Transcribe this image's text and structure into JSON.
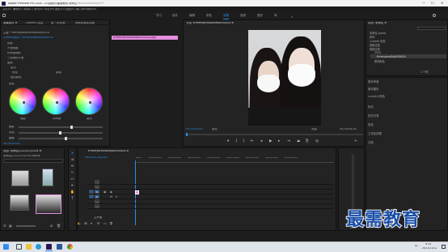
{
  "window": {
    "title": "Adobe Premiere Pro 2020 - D:\\视频\\5\\最需教育 未命名 *7777777777777 *",
    "controls": [
      "—",
      "☐",
      "✕"
    ]
  },
  "menu": [
    "文件(F)",
    "编辑(E)",
    "剪辑(C)",
    "序列(S)",
    "标记(M)",
    "图形(G)",
    "视图(V)",
    "窗口(W)",
    "帮助(H)"
  ],
  "workspaces": {
    "items": [
      "学习",
      "组件",
      "编辑",
      "颜色",
      "效果",
      "音频",
      "图形",
      "库"
    ],
    "active_index": 4
  },
  "effect_controls": {
    "tabs": [
      "效果控件 ≡",
      "Lumetri 范围",
      "源（无剪辑）",
      "音频剪辑混合器"
    ],
    "source_label": "主要 * trimmyand0a00ds0000024",
    "clip_label": "Lumetri颜色 * trimmyand0a0000024",
    "clip_bar_label": "trimmyand0a00ds0000024.jpg",
    "items": [
      "视频",
      "不透明度",
      "时间重映射",
      "三色调色平衡",
      "曲线"
    ],
    "lumetri_rows": [
      "高光",
      "更改颜色"
    ],
    "preset_label": "预设",
    "preset_value": "原始",
    "wheels_label": "色轮",
    "wheel_labels": [
      "阴影",
      "中间调",
      "高光"
    ],
    "sliders": [
      {
        "label": "晕影",
        "value": 0.62
      },
      {
        "label": "羽化",
        "value": 0.48
      },
      {
        "label": "圆度",
        "value": 0.55
      }
    ],
    "timecode": "00:00:00:00"
  },
  "program_monitor": {
    "title": "节目: trimmyand0a00ds0000024 ≡",
    "timecode_left": "00;00;00;00",
    "fit_label": "适合",
    "quality_label": "完整",
    "timecode_right": "00;00;04;24"
  },
  "project": {
    "title": "项目: 未命名 ≡",
    "subtitle": "未命名.prproj",
    "items": [
      "未命名.prproj",
      "序列",
      "Lumetri 颜色",
      "音频过渡",
      "视频过渡",
      "2020",
      "trimmyand0a0000024",
      "更改颜色"
    ],
    "item_count": "1 个项"
  },
  "right_side_panels": [
    "基本声音",
    "基本图形",
    "Lumetri 颜色",
    "标记",
    "历史记录",
    "信息",
    "工作区设置",
    "文档"
  ],
  "media": {
    "title": "项目: 未命名(222222)2224 ≡",
    "subtitle": "未命名(222222)2224.prproj"
  },
  "timeline": {
    "title": "trimmyand0a00ds0000024 ≡",
    "timecode": "00;00;00;00",
    "ruler": [
      "00;00",
      "00;00;02;00",
      "00;00;04;00",
      "00;00;06;00",
      "00;00;08;00",
      "00;00;10;00",
      "00;00;12;00",
      "00;00;14;00",
      "00;00;16;00"
    ],
    "tracks": [
      "V3",
      "V2",
      "V1",
      "A1",
      "A2",
      "A3"
    ],
    "master_label": "主声道"
  },
  "watermark": "最需教育",
  "taskbar": {
    "time": "9:14",
    "date": "2021/11/12",
    "lang": "中"
  },
  "colors": {
    "accent": "#2d8ceb",
    "clip_pink": "#e58ee0",
    "watermark": "#1a4ea8"
  }
}
